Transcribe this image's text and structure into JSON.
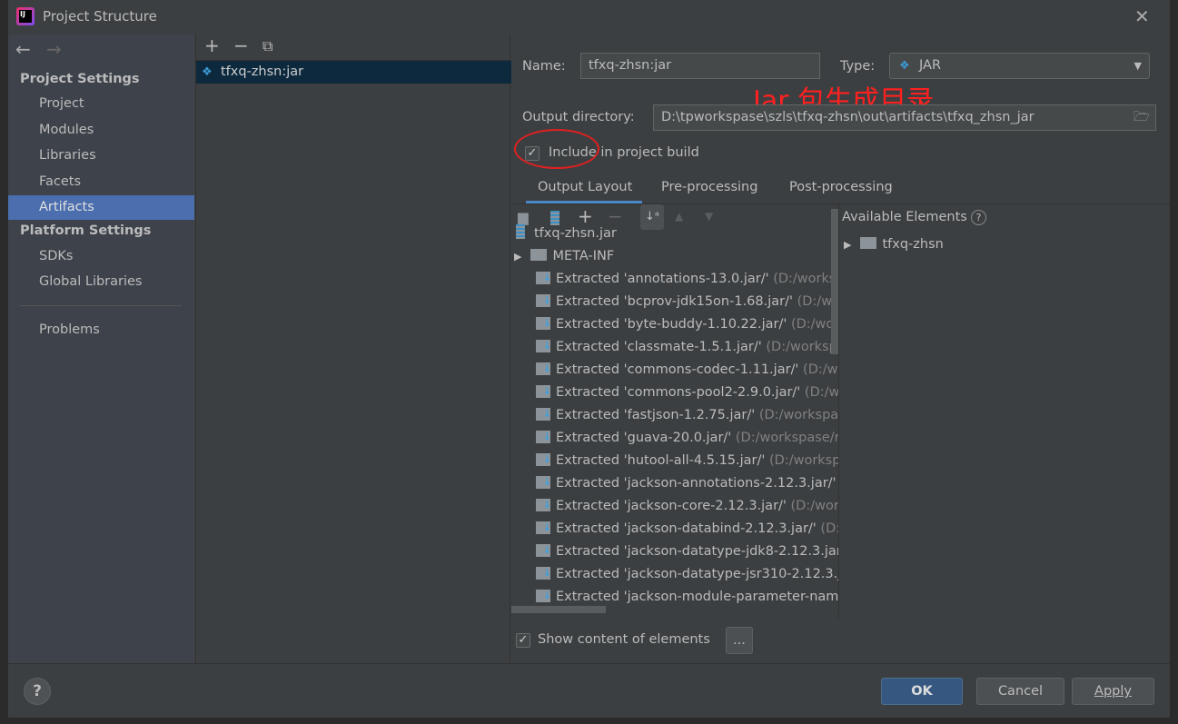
{
  "window": {
    "title": "Project Structure"
  },
  "sidebar": {
    "sections": [
      {
        "label": "Project Settings"
      },
      {
        "label": "Platform Settings"
      }
    ],
    "items": [
      {
        "label": "Project"
      },
      {
        "label": "Modules"
      },
      {
        "label": "Libraries"
      },
      {
        "label": "Facets"
      },
      {
        "label": "Artifacts",
        "selected": true
      },
      {
        "label": "SDKs"
      },
      {
        "label": "Global Libraries"
      },
      {
        "label": "Problems"
      }
    ]
  },
  "artifacts": {
    "items": [
      {
        "label": "tfxq-zhsn:jar"
      }
    ]
  },
  "form": {
    "name_label": "Name:",
    "name_value": "tfxq-zhsn:jar",
    "type_label": "Type:",
    "type_value": "JAR",
    "output_dir_label": "Output directory:",
    "output_dir_value": "D:\\tpworkspase\\szls\\tfxq-zhsn\\out\\artifacts\\tfxq_zhsn_jar",
    "include_label": "Include in project build",
    "include_checked": true
  },
  "annotation": {
    "text": "Jar 包生成目录",
    "color": "#ff2020"
  },
  "tabs": [
    {
      "label": "Output Layout",
      "active": true
    },
    {
      "label": "Pre-processing"
    },
    {
      "label": "Post-processing"
    }
  ],
  "layout_tree": {
    "root": "tfxq-zhsn.jar",
    "folder": "META-INF",
    "extracted_prefix": "Extracted",
    "rows": [
      {
        "name": "'annotations-13.0.jar/'",
        "path": "(D:/worksp"
      },
      {
        "name": "'bcprov-jdk15on-1.68.jar/'",
        "path": "(D:/wo"
      },
      {
        "name": "'byte-buddy-1.10.22.jar/'",
        "path": "(D:/worl"
      },
      {
        "name": "'classmate-1.5.1.jar/'",
        "path": "(D:/workspas"
      },
      {
        "name": "'commons-codec-1.11.jar/'",
        "path": "(D:/wo"
      },
      {
        "name": "'commons-pool2-2.9.0.jar/'",
        "path": "(D:/w"
      },
      {
        "name": "'fastjson-1.2.75.jar/'",
        "path": "(D:/workspas"
      },
      {
        "name": "'guava-20.0.jar/'",
        "path": "(D:/workspase/re"
      },
      {
        "name": "'hutool-all-4.5.15.jar/'",
        "path": "(D:/workspa"
      },
      {
        "name": "'jackson-annotations-2.12.3.jar/'",
        "path": "("
      },
      {
        "name": "'jackson-core-2.12.3.jar/'",
        "path": "(D:/work"
      },
      {
        "name": "'jackson-databind-2.12.3.jar/'",
        "path": "(D:/"
      },
      {
        "name": "'jackson-datatype-jdk8-2.12.3.jar,",
        "path": ""
      },
      {
        "name": "'jackson-datatype-jsr310-2.12.3.ja",
        "path": ""
      },
      {
        "name": "'jackson-module-parameter-nam",
        "path": ""
      }
    ]
  },
  "available": {
    "title": "Available Elements",
    "help": "?",
    "items": [
      {
        "label": "tfxq-zhsn"
      }
    ]
  },
  "show_content": {
    "label": "Show content of elements",
    "checked": true,
    "more": "..."
  },
  "buttons": {
    "ok": "OK",
    "cancel": "Cancel",
    "apply": "Apply",
    "help": "?"
  },
  "colors": {
    "selection": "#4b6eaf",
    "list_selection": "#0d293e",
    "ok_button": "#365880"
  }
}
